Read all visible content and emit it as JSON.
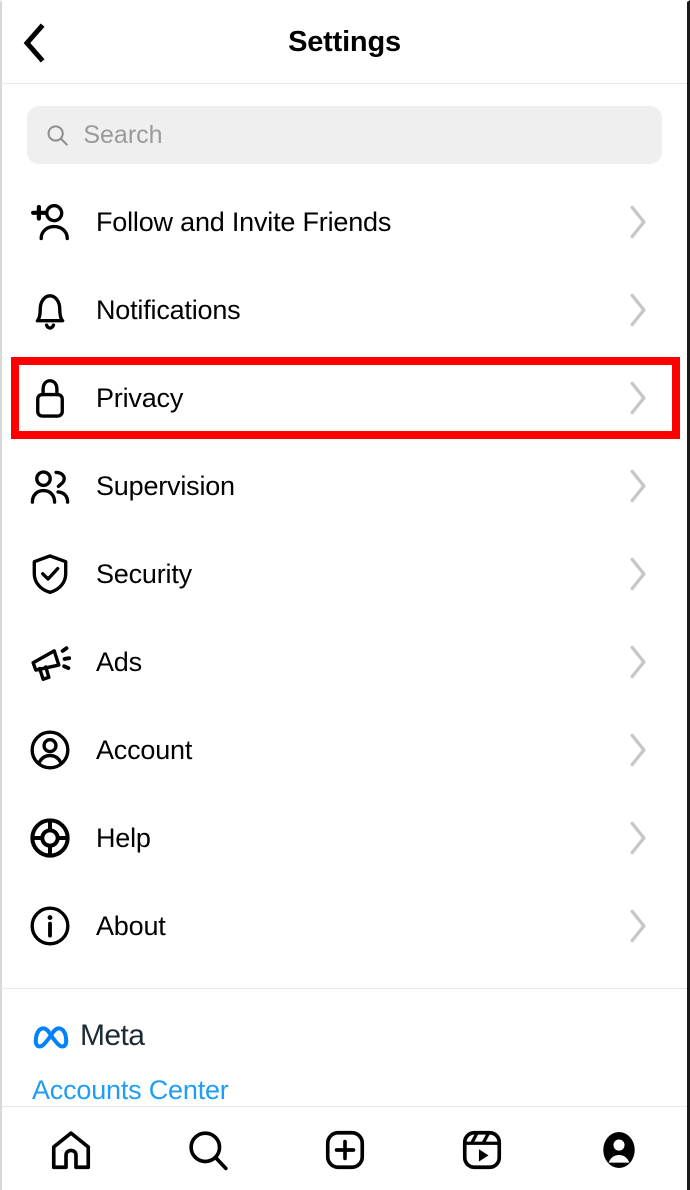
{
  "header": {
    "title": "Settings",
    "back_icon": "chevron-left-icon"
  },
  "search": {
    "placeholder": "Search",
    "value": "",
    "icon": "search-icon"
  },
  "settings_list": [
    {
      "label": "Follow and Invite Friends",
      "icon": "add-person-icon",
      "chevron": "chevron-right-icon",
      "highlighted": false
    },
    {
      "label": "Notifications",
      "icon": "bell-icon",
      "chevron": "chevron-right-icon",
      "highlighted": false
    },
    {
      "label": "Privacy",
      "icon": "lock-icon",
      "chevron": "chevron-right-icon",
      "highlighted": true
    },
    {
      "label": "Supervision",
      "icon": "two-people-icon",
      "chevron": "chevron-right-icon",
      "highlighted": false
    },
    {
      "label": "Security",
      "icon": "shield-check-icon",
      "chevron": "chevron-right-icon",
      "highlighted": false
    },
    {
      "label": "Ads",
      "icon": "megaphone-icon",
      "chevron": "chevron-right-icon",
      "highlighted": false
    },
    {
      "label": "Account",
      "icon": "person-circle-icon",
      "chevron": "chevron-right-icon",
      "highlighted": false
    },
    {
      "label": "Help",
      "icon": "life-ring-icon",
      "chevron": "chevron-right-icon",
      "highlighted": false
    },
    {
      "label": "About",
      "icon": "info-circle-icon",
      "chevron": "chevron-right-icon",
      "highlighted": false
    }
  ],
  "meta_section": {
    "brand": "Meta",
    "brand_icon": "meta-infinity-logo",
    "accounts_center": "Accounts Center"
  },
  "bottom_nav": [
    {
      "name": "home-icon"
    },
    {
      "name": "search-icon"
    },
    {
      "name": "add-post-icon"
    },
    {
      "name": "reels-icon"
    },
    {
      "name": "profile-avatar-icon"
    }
  ],
  "colors": {
    "highlight_box": "#ff0000",
    "link_blue": "#1f9df5",
    "meta_logo_blue": "#0082fb",
    "meta_word": "#1c2b33",
    "search_bg": "#efefef",
    "placeholder_gray": "#9a9a9a",
    "chevron_gray": "#c7c7c7",
    "divider": "#e9e9e9"
  }
}
